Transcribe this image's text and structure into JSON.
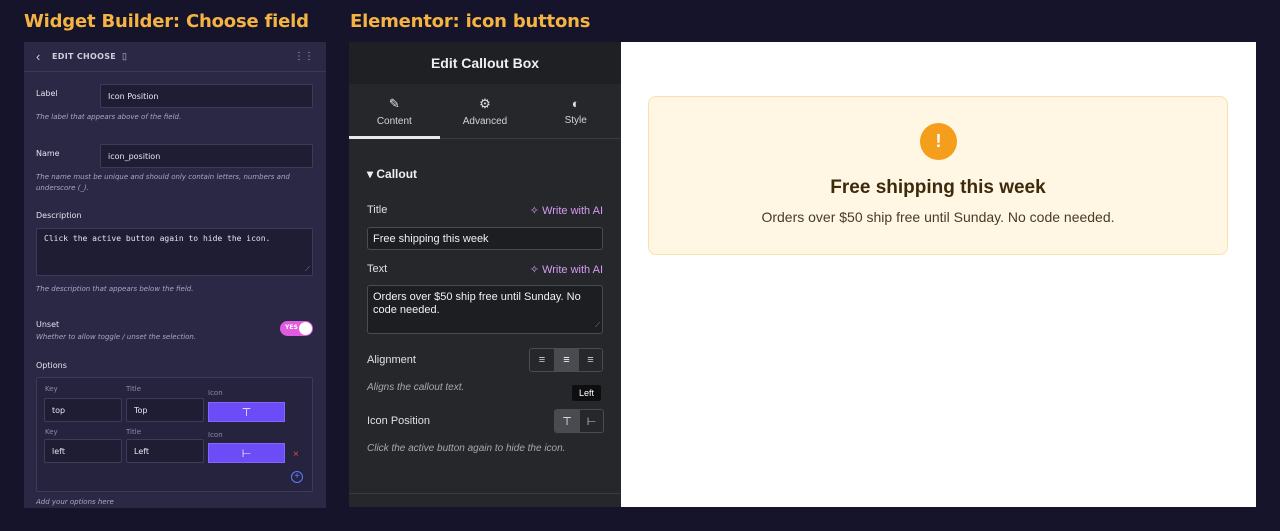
{
  "headings": {
    "left": "Widget Builder: Choose field",
    "right": "Elementor: icon buttons"
  },
  "widget_builder": {
    "header_title": "EDIT CHOOSE",
    "label_field": {
      "label": "Label",
      "value": "Icon Position",
      "hint": "The label that appears above of the field."
    },
    "name_field": {
      "label": "Name",
      "value": "icon_position",
      "hint": "The name must be unique and should only contain letters, numbers and underscore (_)."
    },
    "description_field": {
      "label": "Description",
      "value": "Click the active button again to hide the icon.",
      "hint": "The description that appears below the field."
    },
    "unset_field": {
      "label": "Unset",
      "hint": "Whether to allow toggle / unset the selection.",
      "toggle_text": "YES",
      "on": true
    },
    "options": {
      "label": "Options",
      "col_key": "Key",
      "col_title": "Title",
      "col_icon": "Icon",
      "rows": [
        {
          "key": "top",
          "title": "Top",
          "icon": "⊤"
        },
        {
          "key": "left",
          "title": "Left",
          "icon": "⊢"
        }
      ],
      "remove_glyph": "×",
      "add_glyph": "+",
      "footer_hint": "Add your options here"
    }
  },
  "elementor": {
    "panel_title": "Edit Callout Box",
    "tabs": [
      {
        "label": "Content",
        "icon": "pencil-icon",
        "glyph": "✎"
      },
      {
        "label": "Advanced",
        "icon": "gear-icon",
        "glyph": "⚙"
      },
      {
        "label": "Style",
        "icon": "contrast-icon",
        "glyph": "◐"
      }
    ],
    "section": "Callout",
    "section_caret": "▾",
    "ai_label": "✧ Write with AI",
    "title_field": {
      "label": "Title",
      "value": "Free shipping this week"
    },
    "text_field": {
      "label": "Text",
      "value": "Orders over $50 ship free until Sunday. No code needed."
    },
    "alignment": {
      "label": "Alignment",
      "hint": "Aligns the callout text.",
      "options": [
        "≡",
        "≡",
        "≡"
      ],
      "selected": "center"
    },
    "icon_position": {
      "label": "Icon Position",
      "hint": "Click the active button again to hide the icon.",
      "options": [
        "⊤",
        "⊢"
      ],
      "selected": "top",
      "tooltip": "Left"
    }
  },
  "preview": {
    "badge": "!",
    "title": "Free shipping this week",
    "text": "Orders over $50 ship free until Sunday. No code needed.",
    "colors": {
      "callout_bg": "#fff6e4",
      "callout_border": "#fae0ad",
      "badge": "#f59e1b"
    }
  }
}
